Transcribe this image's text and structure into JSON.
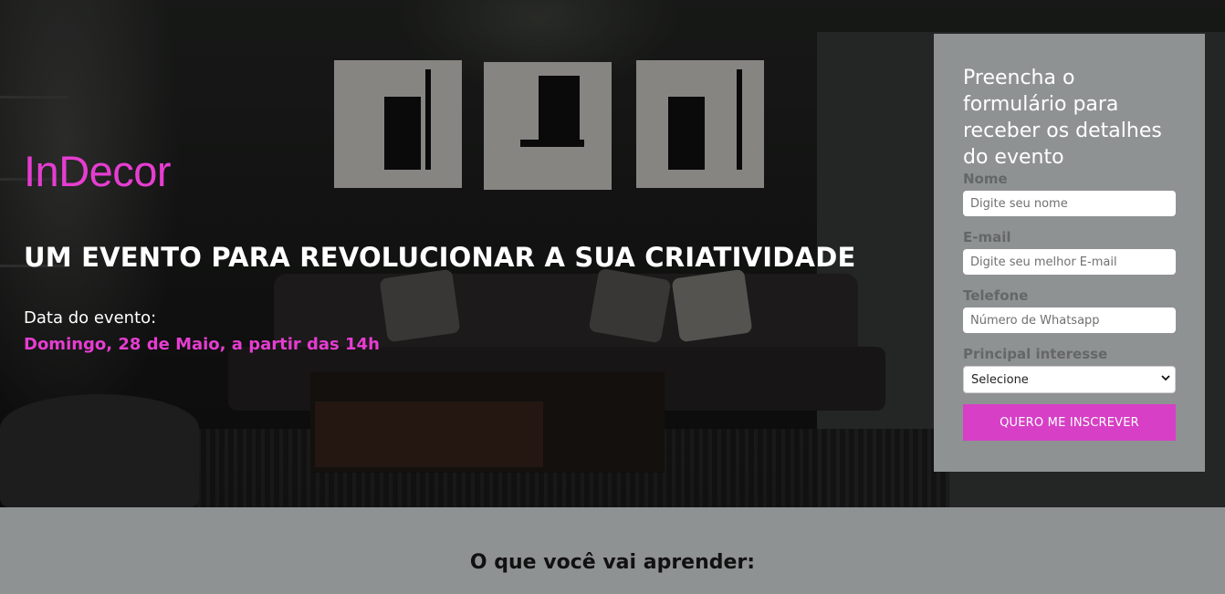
{
  "brand": {
    "name": "InDecor",
    "color": "#e63dd1"
  },
  "hero": {
    "headline": "UM EVENTO PARA REVOLUCIONAR A SUA CRIATIVIDADE",
    "date_label": "Data do evento:",
    "date_value": "Domingo, 28 de Maio, a partir das 14h"
  },
  "form": {
    "title": "Preencha o formulário para receber os detalhes do evento",
    "fields": [
      {
        "label": "Nome",
        "placeholder": "Digite seu nome"
      },
      {
        "label": "E-mail",
        "placeholder": "Digite seu melhor E-mail"
      },
      {
        "label": "Telefone",
        "placeholder": "Número de Whatsapp"
      }
    ],
    "interest": {
      "label": "Principal interesse",
      "selected": "Selecione"
    },
    "submit_label": "QUERO ME INSCREVER",
    "panel_color": "#8f9293",
    "button_color": "#d73fc6"
  },
  "learn_section": {
    "title": "O que você vai aprender:"
  },
  "icons": {
    "select_arrow": "chevron-down-icon"
  }
}
